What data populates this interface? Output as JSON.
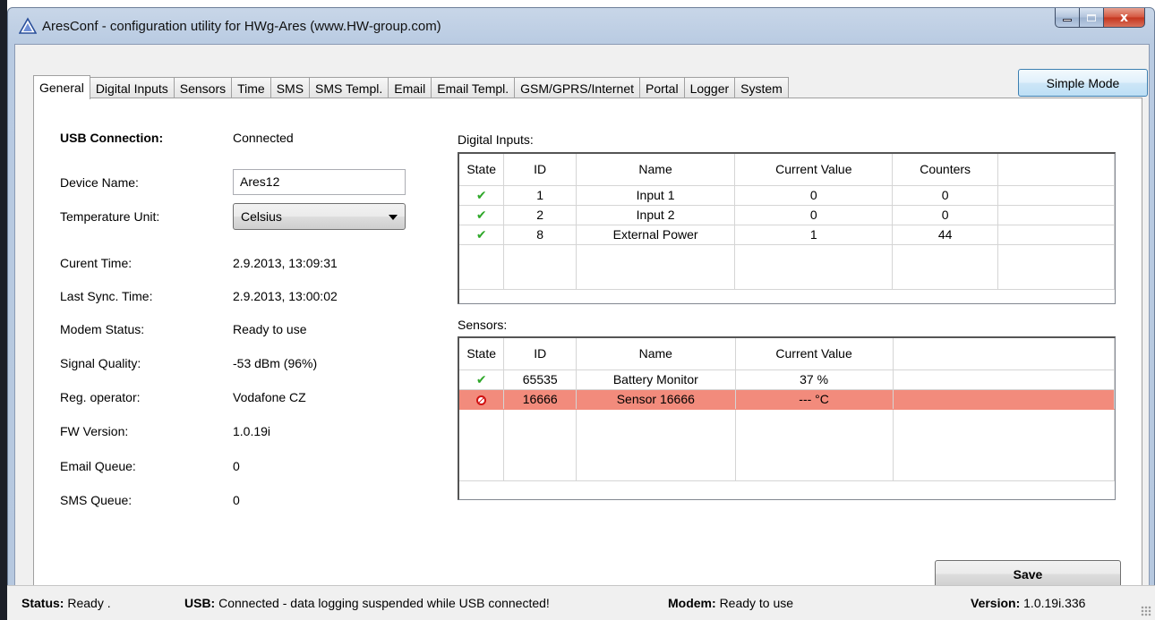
{
  "window": {
    "title": "AresConf - configuration utility for HWg-Ares (www.HW-group.com)",
    "app_icon": "triangle-warning-icon",
    "controls": {
      "minimize": "minimize-icon",
      "maximize": "maximize-icon",
      "close": "x"
    }
  },
  "toolbar": {
    "simple_mode_label": "Simple Mode"
  },
  "tabs": [
    {
      "label": "General",
      "active": true
    },
    {
      "label": "Digital Inputs"
    },
    {
      "label": "Sensors"
    },
    {
      "label": "Time"
    },
    {
      "label": "SMS"
    },
    {
      "label": "SMS Templ."
    },
    {
      "label": "Email"
    },
    {
      "label": "Email Templ."
    },
    {
      "label": "GSM/GPRS/Internet"
    },
    {
      "label": "Portal"
    },
    {
      "label": "Logger"
    },
    {
      "label": "System"
    }
  ],
  "general": {
    "usb_connection_label": "USB Connection:",
    "usb_connection_value": "Connected",
    "device_name_label": "Device Name:",
    "device_name_value": "Ares12",
    "temperature_unit_label": "Temperature Unit:",
    "temperature_unit_value": "Celsius",
    "current_time_label": "Curent Time:",
    "current_time_value": "2.9.2013, 13:09:31",
    "last_sync_label": "Last Sync. Time:",
    "last_sync_value": "2.9.2013, 13:00:02",
    "modem_status_label": "Modem Status:",
    "modem_status_value": "Ready to use",
    "signal_quality_label": "Signal Quality:",
    "signal_quality_value": "-53 dBm (96%)",
    "reg_operator_label": "Reg. operator:",
    "reg_operator_value": "Vodafone CZ",
    "fw_version_label": "FW Version:",
    "fw_version_value": "1.0.19i",
    "email_queue_label": "Email Queue:",
    "email_queue_value": "0",
    "sms_queue_label": "SMS Queue:",
    "sms_queue_value": "0"
  },
  "digital_inputs": {
    "title": "Digital Inputs:",
    "columns": [
      "State",
      "ID",
      "Name",
      "Current Value",
      "Counters"
    ],
    "rows": [
      {
        "state": "✔",
        "state_icon": "check-icon",
        "id": "1",
        "name": "Input 1",
        "value": "0",
        "counters": "0"
      },
      {
        "state": "✔",
        "state_icon": "check-icon",
        "id": "2",
        "name": "Input 2",
        "value": "0",
        "counters": "0"
      },
      {
        "state": "✔",
        "state_icon": "check-icon",
        "id": "8",
        "name": "External Power",
        "value": "1",
        "counters": "44"
      }
    ]
  },
  "sensors": {
    "title": "Sensors:",
    "columns": [
      "State",
      "ID",
      "Name",
      "Current Value"
    ],
    "rows": [
      {
        "state": "✔",
        "state_icon": "check-icon",
        "id": "65535",
        "name": "Battery Monitor",
        "value": "37 %"
      },
      {
        "state_icon": "error-icon",
        "id": "16666",
        "name": "Sensor 16666",
        "value": "--- °C",
        "alert_color": "#f28b7c"
      }
    ]
  },
  "actions": {
    "save_label": "Save"
  },
  "statusbar": {
    "status_label": "Status:",
    "status_value": "Ready .",
    "usb_label": "USB:",
    "usb_value": "Connected - data logging suspended while USB connected!",
    "modem_label": "Modem:",
    "modem_value": "Ready to use",
    "version_label": "Version:",
    "version_value": "1.0.19i.336"
  }
}
